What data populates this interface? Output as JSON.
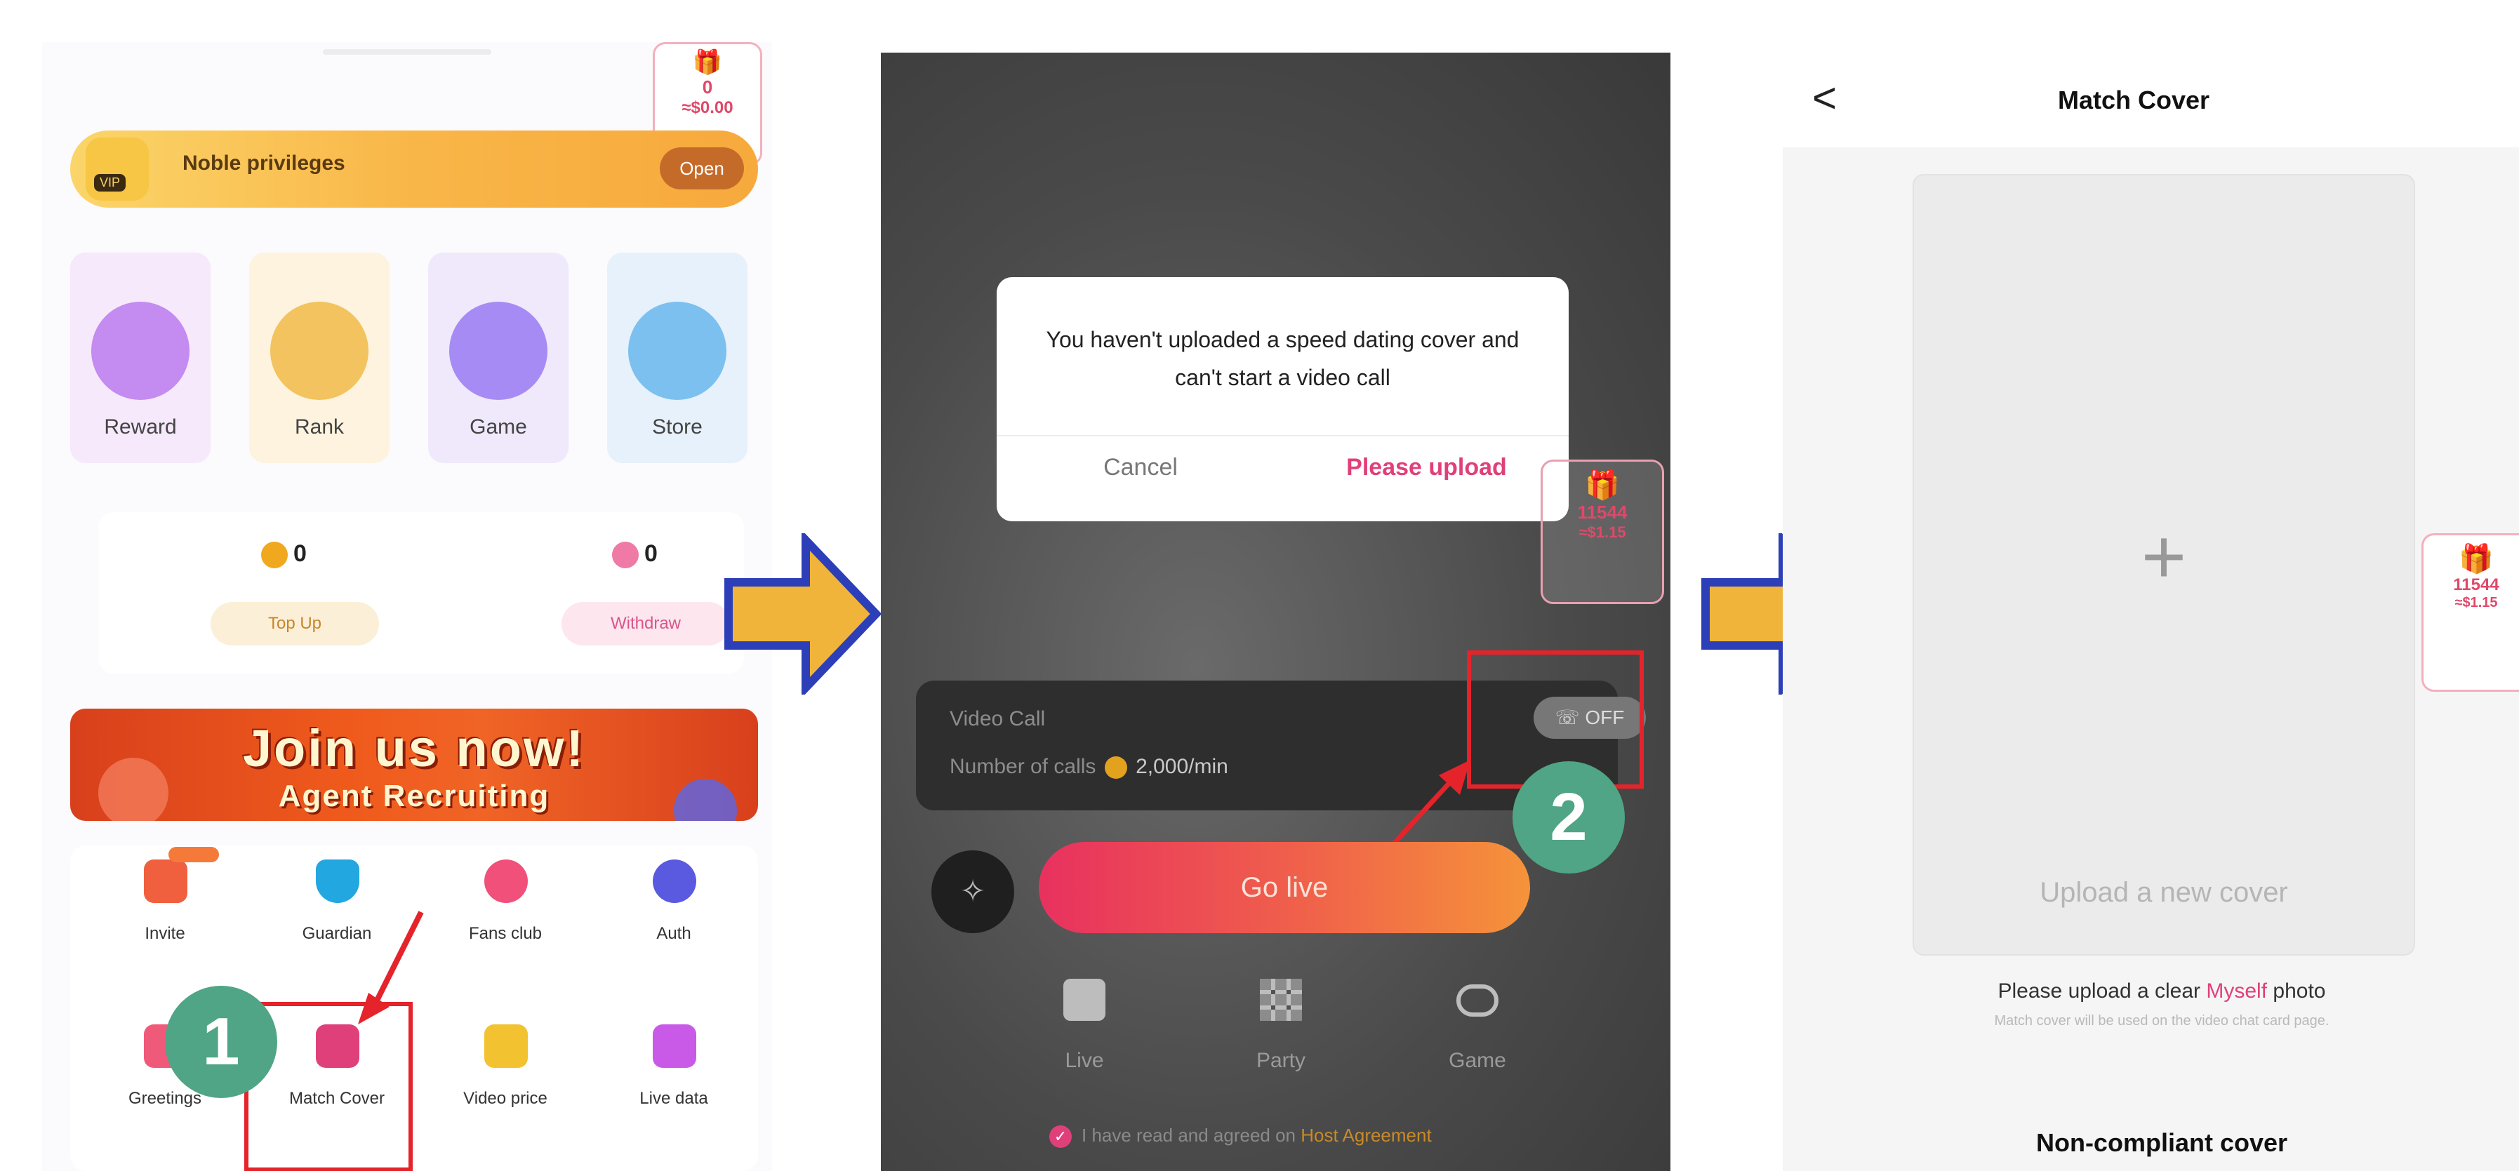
{
  "panel1": {
    "gift_badge": {
      "count": "0",
      "value": "≈$0.00"
    },
    "noble": {
      "label": "Noble privileges",
      "vip": "VIP",
      "open": "Open"
    },
    "tiles": [
      {
        "label": "Reward",
        "color": "#c48bf0"
      },
      {
        "label": "Rank",
        "color": "#f2c35e"
      },
      {
        "label": "Game",
        "color": "#a78bf5"
      },
      {
        "label": "Store",
        "color": "#7cc0f0"
      }
    ],
    "wallet": {
      "topup_amount": "0",
      "topup_label": "Top Up",
      "withdraw_amount": "0",
      "withdraw_label": "Withdraw"
    },
    "banner": {
      "line1": "Join us now!",
      "line2": "Agent Recruiting"
    },
    "grid": [
      {
        "label": "Invite",
        "icon": "gift-icon",
        "color": "#f0603e"
      },
      {
        "label": "Guardian",
        "icon": "shield-icon",
        "color": "#22a7e0"
      },
      {
        "label": "Fans club",
        "icon": "hearts-icon",
        "color": "#f0507a"
      },
      {
        "label": "Auth",
        "icon": "verified-icon",
        "color": "#5a5ae0"
      },
      {
        "label": "Greetings",
        "icon": "hi-icon",
        "color": "#f05a7a"
      },
      {
        "label": "Match Cover",
        "icon": "portrait-icon",
        "color": "#e0407a"
      },
      {
        "label": "Video price",
        "icon": "wallet-icon",
        "color": "#f2c230"
      },
      {
        "label": "Live data",
        "icon": "chart-icon",
        "color": "#c95ae8"
      }
    ],
    "step": "1"
  },
  "panel2": {
    "dialog": {
      "message": "You haven't uploaded a speed dating cover and can't start a video call",
      "cancel": "Cancel",
      "upload": "Please upload"
    },
    "gift_badge": {
      "count": "11544",
      "value": "≈$1.15"
    },
    "video_call": {
      "title": "Video Call",
      "calls_label": "Number of calls",
      "calls_value": "2,000/min",
      "toggle": "OFF"
    },
    "go_live": "Go live",
    "modes": [
      {
        "label": "Live",
        "icon": "tv-icon"
      },
      {
        "label": "Party",
        "icon": "grid-icon"
      },
      {
        "label": "Game",
        "icon": "gamepad-icon"
      }
    ],
    "agreement": {
      "text": "I have read and agreed on",
      "link": "Host Agreement"
    },
    "step": "2"
  },
  "panel3": {
    "back": "<",
    "title": "Match Cover",
    "upload_text": "Upload a new cover",
    "hint_prefix": "Please upload a clear ",
    "hint_highlight": "Myself",
    "hint_suffix": " photo",
    "sub_hint": "Match cover will be used on the video chat card page.",
    "non_compliant": "Non-compliant cover",
    "gift_badge": {
      "count": "11544",
      "value": "≈$1.15"
    }
  },
  "colors": {
    "arrow_fill": "#f0b43a",
    "arrow_stroke": "#2c3fb8",
    "step_green": "#4fa585",
    "highlight_red": "#e5232b",
    "accent_pink": "#e0407a"
  }
}
